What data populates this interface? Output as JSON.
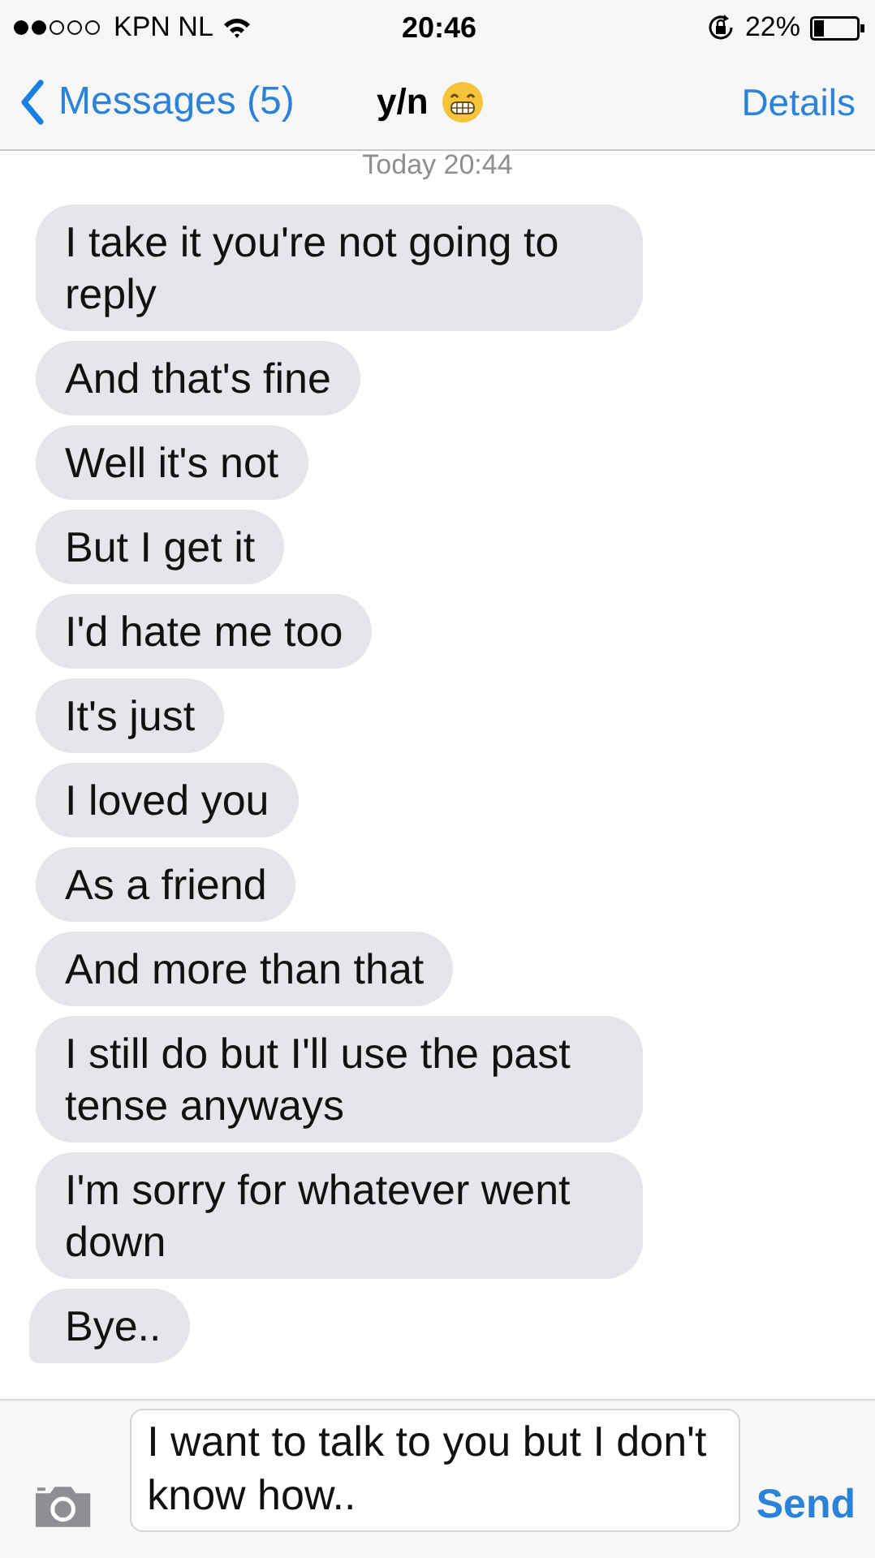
{
  "status_bar": {
    "carrier": "KPN NL",
    "time": "20:46",
    "battery": "22%"
  },
  "nav": {
    "back": "Messages (5)",
    "title": "y/n",
    "action": "Details"
  },
  "timestamp": "Today 20:44",
  "messages": [
    {
      "text": "I take it you're not going to reply",
      "tail": false
    },
    {
      "text": "And that's fine",
      "tail": false
    },
    {
      "text": "Well it's not",
      "tail": false
    },
    {
      "text": "But I get it",
      "tail": false
    },
    {
      "text": "I'd hate me too",
      "tail": false
    },
    {
      "text": "It's just",
      "tail": false
    },
    {
      "text": "I loved you",
      "tail": false
    },
    {
      "text": "As a friend",
      "tail": false
    },
    {
      "text": "And more than that",
      "tail": false
    },
    {
      "text": "I still do but I'll use the past tense anyways",
      "tail": false
    },
    {
      "text": "I'm sorry for whatever went down",
      "tail": false
    },
    {
      "text": "Bye..",
      "tail": true
    }
  ],
  "composer": {
    "value": "I want to talk to you but I don't know how..",
    "send": "Send"
  }
}
